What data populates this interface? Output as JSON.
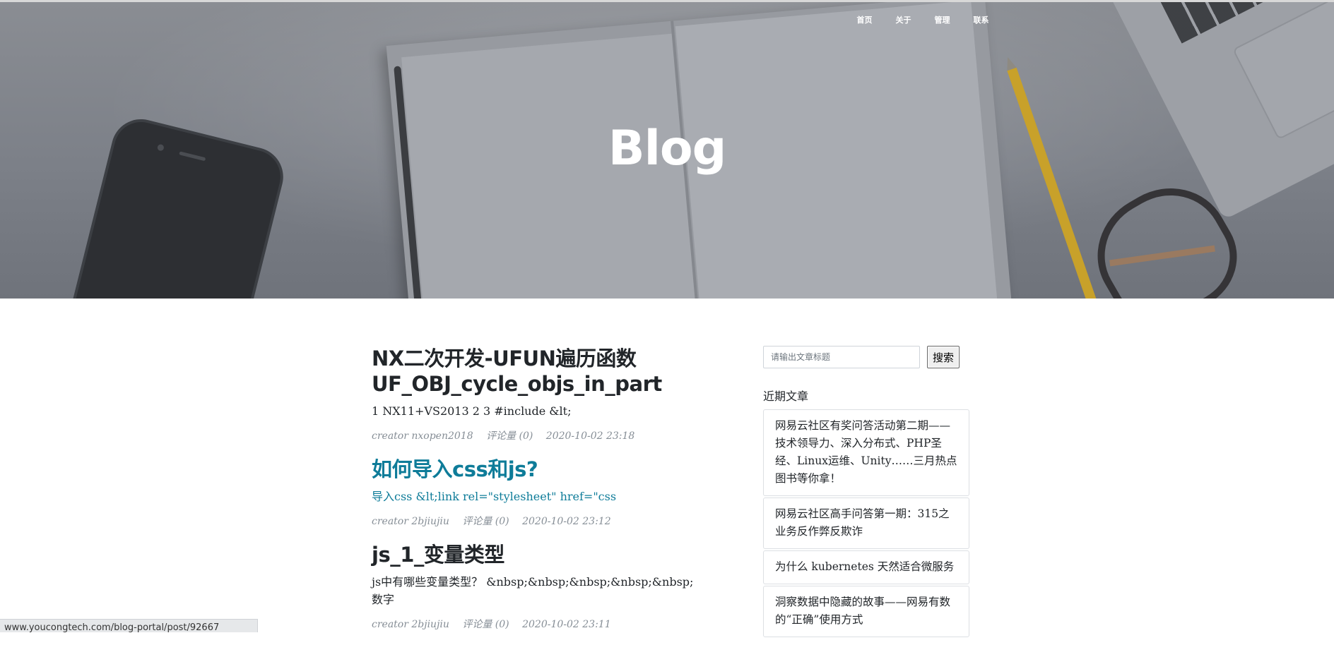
{
  "hero": {
    "title": "Blog",
    "nav": [
      "首页",
      "关于",
      "管理",
      "联系"
    ]
  },
  "posts": [
    {
      "title": "NX二次开发-UFUN遍历函数UF_OBJ_cycle_objs_in_part",
      "excerpt": "1 NX11+VS2013 2 3 #include &lt;",
      "creator": "creator nxopen2018",
      "comments": "评论量 (0)",
      "date": "2020-10-02 23:18"
    },
    {
      "title": "如何导入css和js?",
      "excerpt": "导入css &lt;link rel=\"stylesheet\" href=\"css",
      "creator": "creator 2bjiujiu",
      "comments": "评论量 (0)",
      "date": "2020-10-02 23:12"
    },
    {
      "title": "js_1_变量类型",
      "excerpt": "js中有哪些变量类型？ &nbsp;&nbsp;&nbsp;&nbsp;&nbsp; 数字",
      "creator": "creator 2bjiujiu",
      "comments": "评论量 (0)",
      "date": "2020-10-02 23:11"
    }
  ],
  "sidebar": {
    "search_placeholder": "请输出文章标题",
    "search_button": "搜索",
    "recent_heading": "近期文章",
    "recent": [
      "网易云社区有奖问答活动第二期——技术领导力、深入分布式、PHP圣经、Linux运维、Unity……三月热点图书等你拿！",
      "网易云社区高手问答第一期：315之业务反作弊反欺诈",
      "为什么 kubernetes 天然适合微服务",
      "洞察数据中隐藏的故事——网易有数的“正确”使用方式"
    ]
  },
  "status_url": "www.youcongtech.com/blog-portal/post/92667"
}
